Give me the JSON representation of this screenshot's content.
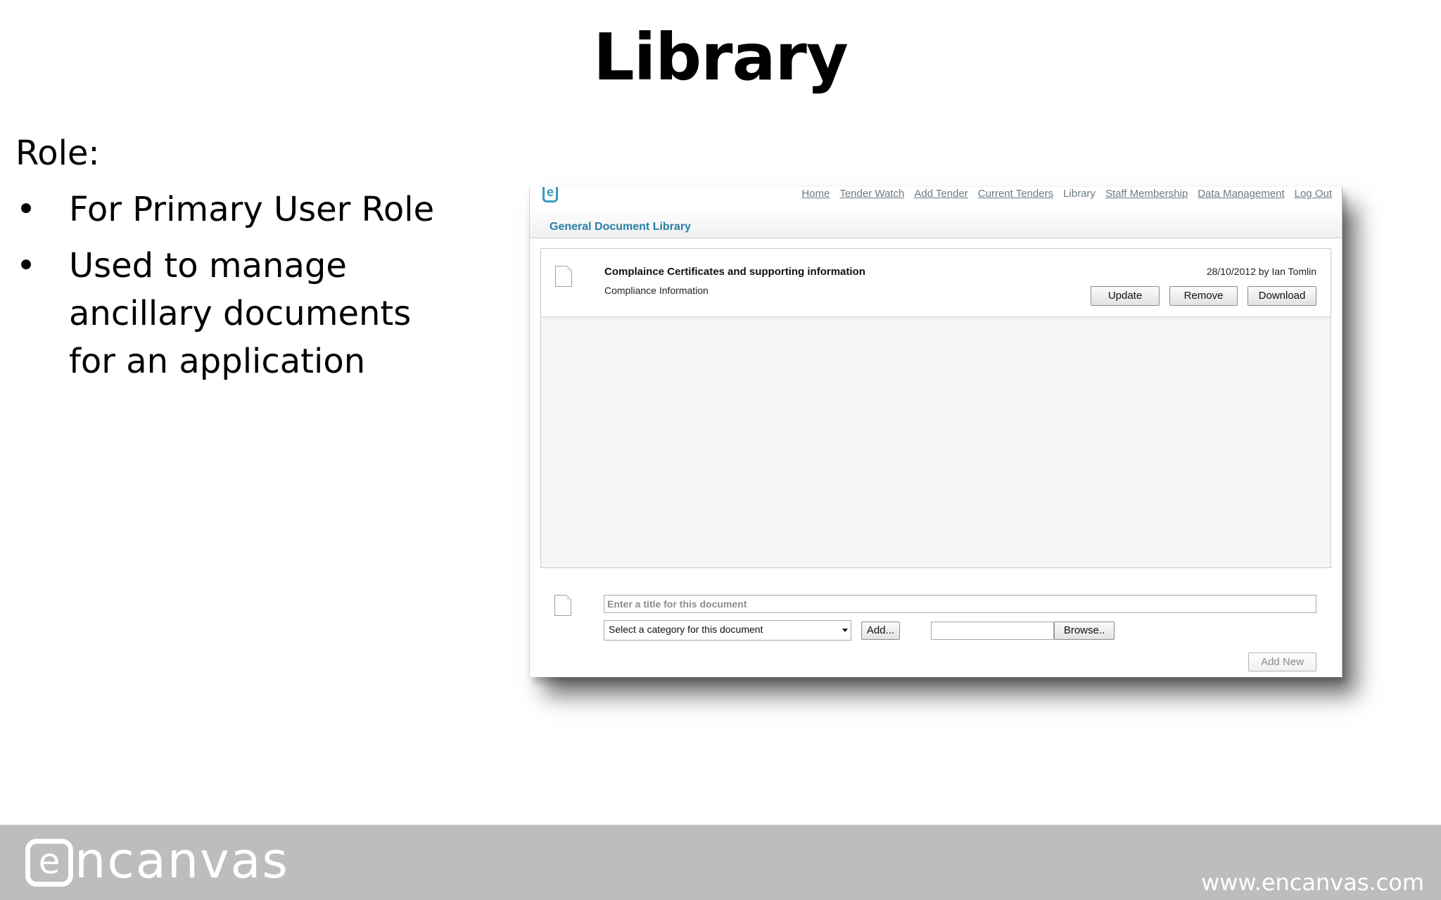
{
  "slide": {
    "title": "Library",
    "role_label": "Role:",
    "bullets": [
      "For Primary User Role",
      "Used to manage ancillary documents for an application"
    ],
    "bullet_glyph": "•"
  },
  "app": {
    "logo_letter": "e",
    "nav": [
      {
        "label": "Home",
        "current": false
      },
      {
        "label": "Tender Watch",
        "current": false
      },
      {
        "label": "Add Tender",
        "current": false
      },
      {
        "label": "Current Tenders",
        "current": false
      },
      {
        "label": "Library",
        "current": true
      },
      {
        "label": "Staff Membership",
        "current": false
      },
      {
        "label": "Data Management",
        "current": false
      },
      {
        "label": "Log Out",
        "current": false
      }
    ],
    "page_heading": "General Document Library",
    "documents": [
      {
        "title": "Complaince Certificates and supporting information",
        "category": "Compliance Information",
        "meta": "28/10/2012 by Ian Tomlin",
        "actions": {
          "update": "Update",
          "remove": "Remove",
          "download": "Download"
        }
      }
    ],
    "new_document": {
      "title_placeholder": "Enter a title for this document",
      "category_selected": "Select a category for this document",
      "add_category_label": "Add...",
      "file_path_value": "",
      "browse_label": "Browse..",
      "add_new_label": "Add New"
    },
    "colors": {
      "accent": "#2a7fa6",
      "nav_link": "#6b7a86"
    }
  },
  "footer": {
    "logo_mark": "e",
    "logo_text": "ncanvas",
    "url": "www.encanvas.com",
    "background": "#bebdbe"
  }
}
